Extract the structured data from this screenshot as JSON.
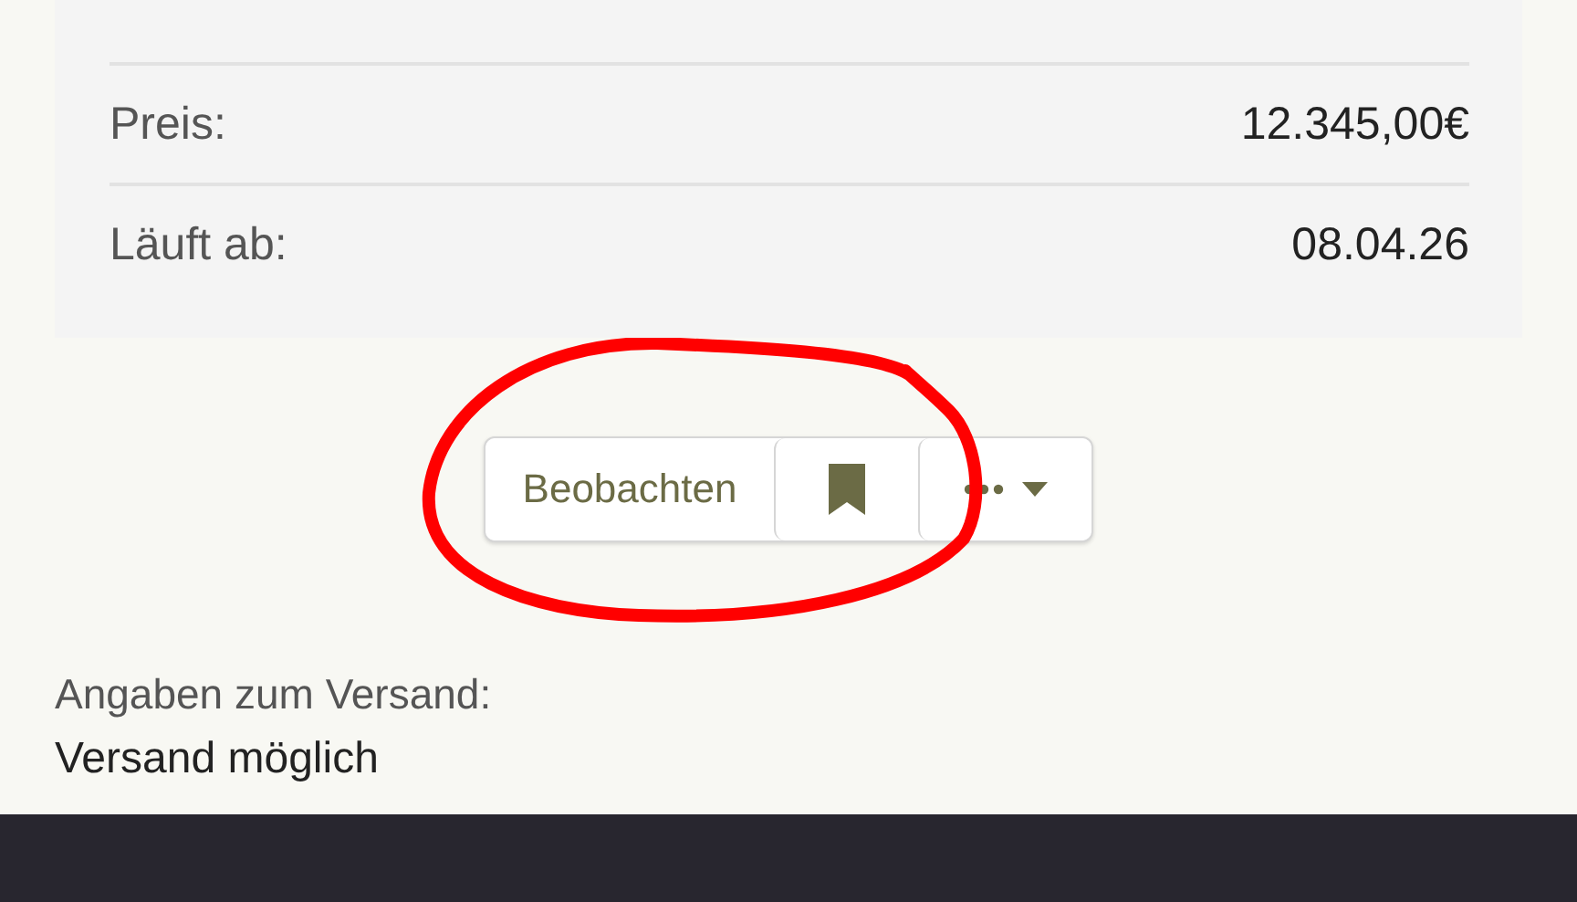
{
  "details": [
    {
      "label": "Preis:",
      "value": "12.345,00€"
    },
    {
      "label": "Läuft ab:",
      "value": "08.04.26"
    }
  ],
  "actions": {
    "watch_label": "Beobachten"
  },
  "shipping": {
    "heading": "Angaben zum Versand:",
    "text": "Versand möglich"
  }
}
